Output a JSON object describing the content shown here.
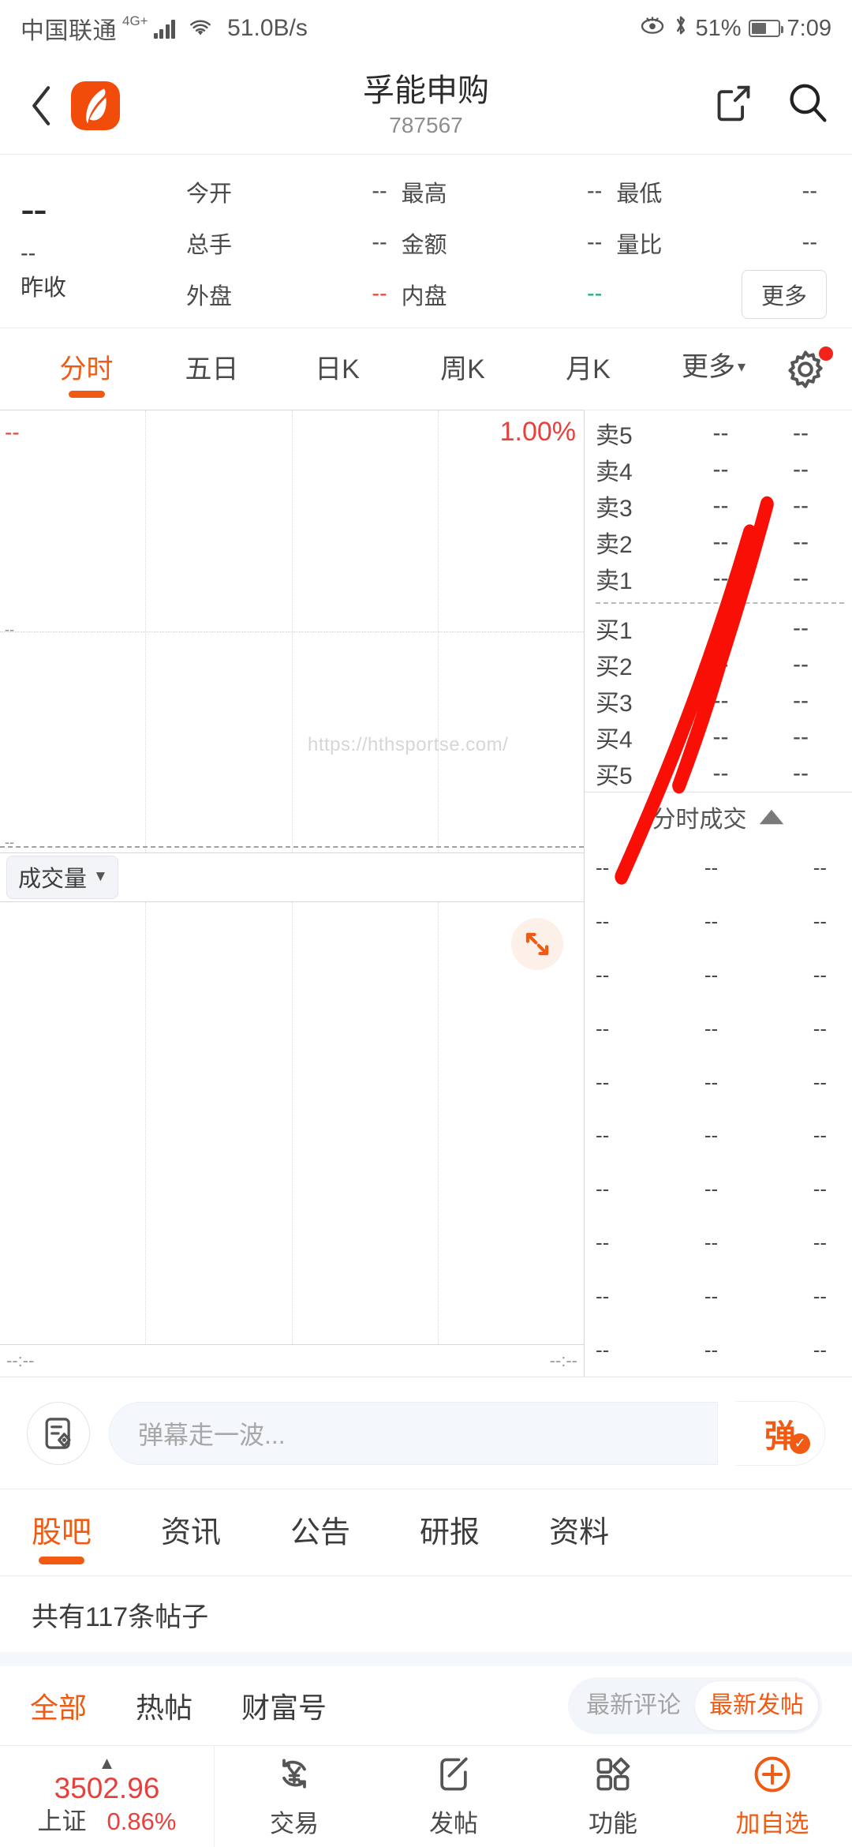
{
  "status_bar": {
    "carrier": "中国联通",
    "network": "4G+",
    "speed": "51.0B/s",
    "battery_percent": "51%",
    "time": "7:09",
    "icons": [
      "signal-icon",
      "wifi-icon",
      "eye-comfort-icon",
      "bluetooth-icon",
      "battery-icon"
    ]
  },
  "navbar": {
    "back_icon": "chevron-left-icon",
    "logo": "app-logo",
    "title": "孚能申购",
    "code": "787567",
    "share_icon": "share-icon",
    "search_icon": "search-icon"
  },
  "quote": {
    "price": "--",
    "change": "--",
    "change_percent": "--",
    "prev_close_label": "昨收",
    "more_label": "更多",
    "fields": [
      {
        "label": "今开",
        "value": "--",
        "color": "default"
      },
      {
        "label": "最高",
        "value": "--",
        "color": "default"
      },
      {
        "label": "最低",
        "value": "--",
        "color": "default"
      },
      {
        "label": "总手",
        "value": "--",
        "color": "default"
      },
      {
        "label": "金额",
        "value": "--",
        "color": "default"
      },
      {
        "label": "量比",
        "value": "--",
        "color": "default"
      },
      {
        "label": "外盘",
        "value": "--",
        "color": "default"
      },
      {
        "label": "内盘",
        "value": "--",
        "color": "red"
      },
      {
        "label": "",
        "value": "--",
        "color": "green"
      }
    ]
  },
  "chart_tabs": {
    "items": [
      {
        "label": "分时",
        "active": true
      },
      {
        "label": "五日",
        "active": false
      },
      {
        "label": "日K",
        "active": false
      },
      {
        "label": "周K",
        "active": false
      },
      {
        "label": "月K",
        "active": false
      },
      {
        "label": "更多",
        "active": false,
        "has_caret": true
      }
    ],
    "settings_icon": "gear-icon",
    "settings_badge": true
  },
  "chart_data": {
    "type": "line",
    "title": "分时",
    "series": [
      {
        "name": "price",
        "values": []
      }
    ],
    "upper_pct_label": "1.00%",
    "upper_left_value": "--",
    "mid_left_value": "--",
    "bottom_left_value": "--",
    "volume_label": "成交量",
    "time_start": "--:--",
    "time_end": "--:--",
    "watermark": "https://hthsportse.com/",
    "grid": true,
    "expand_icon": "fullscreen-expand-icon"
  },
  "order_book": {
    "asks": [
      {
        "label": "卖5",
        "price": "--",
        "volume": "--"
      },
      {
        "label": "卖4",
        "price": "--",
        "volume": "--"
      },
      {
        "label": "卖3",
        "price": "--",
        "volume": "--"
      },
      {
        "label": "卖2",
        "price": "--",
        "volume": "--"
      },
      {
        "label": "卖1",
        "price": "--",
        "volume": "--"
      }
    ],
    "bids": [
      {
        "label": "买1",
        "price": "--",
        "volume": "--"
      },
      {
        "label": "买2",
        "price": "--",
        "volume": "--"
      },
      {
        "label": "买3",
        "price": "--",
        "volume": "--"
      },
      {
        "label": "买4",
        "price": "--",
        "volume": "--"
      },
      {
        "label": "买5",
        "price": "--",
        "volume": "--"
      }
    ]
  },
  "trades": {
    "header": "分时成交",
    "toggle_icon": "triangle-up-icon",
    "rows": [
      {
        "time": "--",
        "price": "--",
        "volume": "--"
      },
      {
        "time": "--",
        "price": "--",
        "volume": "--"
      },
      {
        "time": "--",
        "price": "--",
        "volume": "--"
      },
      {
        "time": "--",
        "price": "--",
        "volume": "--"
      },
      {
        "time": "--",
        "price": "--",
        "volume": "--"
      },
      {
        "time": "--",
        "price": "--",
        "volume": "--"
      },
      {
        "time": "--",
        "price": "--",
        "volume": "--"
      },
      {
        "time": "--",
        "price": "--",
        "volume": "--"
      },
      {
        "time": "--",
        "price": "--",
        "volume": "--"
      },
      {
        "time": "--",
        "price": "--",
        "volume": "--"
      }
    ]
  },
  "danmaku": {
    "left_icon": "note-pin-icon",
    "placeholder": "弹幕走一波...",
    "value": "",
    "send_label": "弹",
    "send_badge_icon": "check-circle-icon"
  },
  "content_tabs": {
    "items": [
      {
        "label": "股吧",
        "active": true
      },
      {
        "label": "资讯",
        "active": false
      },
      {
        "label": "公告",
        "active": false
      },
      {
        "label": "研报",
        "active": false
      },
      {
        "label": "资料",
        "active": false
      }
    ]
  },
  "post_list": {
    "count_text": "共有117条帖子",
    "filters": [
      {
        "label": "全部",
        "active": true
      },
      {
        "label": "热帖",
        "active": false
      },
      {
        "label": "财富号",
        "active": false
      }
    ],
    "sort": [
      {
        "label": "最新评论",
        "active": false
      },
      {
        "label": "最新发帖",
        "active": true
      }
    ]
  },
  "bottom_nav": {
    "index": {
      "name": "上证",
      "value": "3502.96",
      "change_percent": "0.86%",
      "direction_icon": "triangle-up-icon"
    },
    "items": [
      {
        "label": "交易",
        "icon": "yen-refresh-icon",
        "accent": false
      },
      {
        "label": "发帖",
        "icon": "compose-icon",
        "accent": false
      },
      {
        "label": "功能",
        "icon": "grid-icon",
        "accent": false
      },
      {
        "label": "加自选",
        "icon": "plus-circle-icon",
        "accent": true
      }
    ]
  },
  "colors": {
    "accent": "#f15a13",
    "up_red": "#e8413c",
    "down_green": "#12b36a",
    "annotation": "#fa0f07",
    "text": "#3c3c3c",
    "muted": "#9a9a9a"
  }
}
